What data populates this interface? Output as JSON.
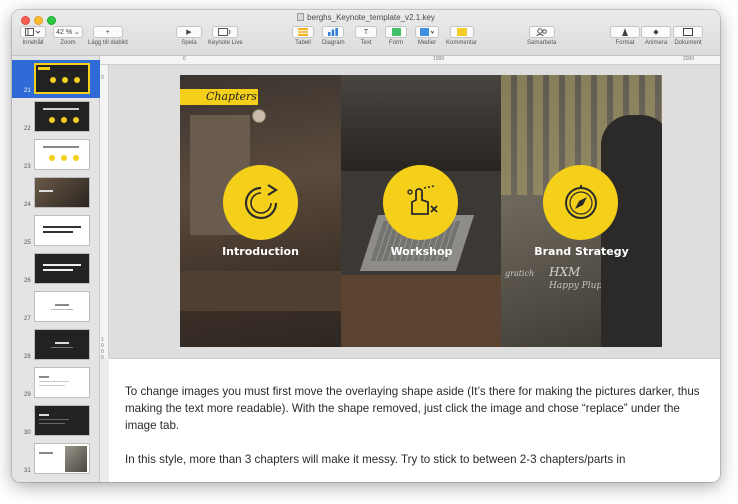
{
  "window": {
    "title": "berghs_Keynote_template_v2.1.key"
  },
  "toolbar": {
    "view_label": "Innehåll",
    "zoom_value": "42 %",
    "zoom_label": "Zoom",
    "add_slide_label": "Lägg till diabild",
    "play_label": "Spela",
    "keynote_live_label": "Keynote Live",
    "table_label": "Tabell",
    "chart_label": "Diagram",
    "text_label": "Text",
    "shape_label": "Form",
    "media_label": "Medier",
    "comment_label": "Kommentar",
    "collaborate_label": "Samarbeta",
    "format_label": "Format",
    "animate_label": "Animera",
    "document_label": "Dokument"
  },
  "ruler": {
    "top_ticks": [
      "0",
      "1000",
      "2000"
    ],
    "left_ticks": [
      "0",
      "1",
      "0",
      "0",
      "0"
    ]
  },
  "navigator": {
    "slides": [
      {
        "number": "21",
        "selected": true,
        "style": "dark-circles"
      },
      {
        "number": "22",
        "selected": false,
        "style": "dark-circles"
      },
      {
        "number": "23",
        "selected": false,
        "style": "light-circles"
      },
      {
        "number": "24",
        "selected": false,
        "style": "photo"
      },
      {
        "number": "25",
        "selected": false,
        "style": "light-text"
      },
      {
        "number": "26",
        "selected": false,
        "style": "dark-text"
      },
      {
        "number": "27",
        "selected": false,
        "style": "light-small"
      },
      {
        "number": "28",
        "selected": false,
        "style": "dark-small"
      },
      {
        "number": "29",
        "selected": false,
        "style": "light-list"
      },
      {
        "number": "30",
        "selected": false,
        "style": "dark-list"
      },
      {
        "number": "31",
        "selected": false,
        "style": "light-photo"
      }
    ]
  },
  "slide": {
    "tag": "Chapters",
    "chapters": [
      {
        "label": "Introduction",
        "icon": "refresh-arrow-icon"
      },
      {
        "label": "Workshop",
        "icon": "hand-touch-icon"
      },
      {
        "label": "Brand Strategy",
        "icon": "compass-icon"
      }
    ],
    "whiteboard_text_1": "HXM",
    "whiteboard_text_2": "Happy Plups",
    "whiteboard_text_3": "gratich"
  },
  "notes": {
    "paragraph_1": "To change images you must first move the overlaying shape aside (It’s there for making the pictures darker, thus making the text more readable). With the shape removed, just click the image and chose “replace” under the image tab.",
    "paragraph_2": "In this style, more than 3 chapters will make it messy. Try to stick to between 2-3 chapters/parts in"
  },
  "colors": {
    "accent": "#f5d01b",
    "selection": "#2e6bd6"
  }
}
